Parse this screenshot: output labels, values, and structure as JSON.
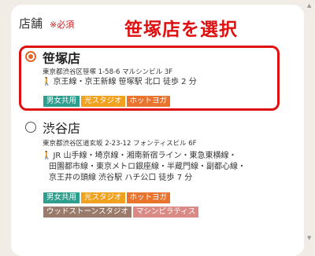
{
  "section": {
    "heading": "店舗",
    "required": "※必須",
    "callout": "笹塚店を選択"
  },
  "stores": [
    {
      "name": "笹塚店",
      "selected": true,
      "address": "東京都渋谷区笹塚 1-58-6 マルシンビル 3F",
      "access_lines": [
        "京王線・京王新線 笹塚駅 北口 徒歩 2 分"
      ],
      "tags": [
        {
          "label": "男女共用",
          "color": "#2e9e8e"
        },
        {
          "label": "光スタジオ",
          "color": "#f0a21f"
        },
        {
          "label": "ホットヨガ",
          "color": "#e8742e"
        }
      ]
    },
    {
      "name": "渋谷店",
      "selected": false,
      "address": "東京都渋谷区道玄坂 2-23-12 フォンティスビル 6F",
      "access_lines": [
        "JR 山手線・埼京線・湘南新宿ライン・東急東横線・",
        "田園都市線・東京メトロ銀座線・半蔵門線・副都心線・",
        "京王井の頭線 渋谷駅 ハチ公口 徒歩 7 分"
      ],
      "tags": [
        {
          "label": "男女共用",
          "color": "#2e9e8e"
        },
        {
          "label": "光スタジオ",
          "color": "#f0a21f"
        },
        {
          "label": "ホットヨガ",
          "color": "#e8742e"
        }
      ],
      "tags_row2": [
        {
          "label": "ウッドストーンスタジオ",
          "color": "#9a7a6a"
        },
        {
          "label": "マシンピラティス",
          "color": "#d98a84"
        }
      ]
    }
  ],
  "icons": {
    "walk": "walking-person-icon",
    "scroll_up": "scroll-up-arrow-icon",
    "scroll_down": "scroll-down-arrow-icon"
  },
  "colors": {
    "accent_red": "#e01010",
    "radio_orange": "#e0672a",
    "background": "#f1ede6"
  }
}
